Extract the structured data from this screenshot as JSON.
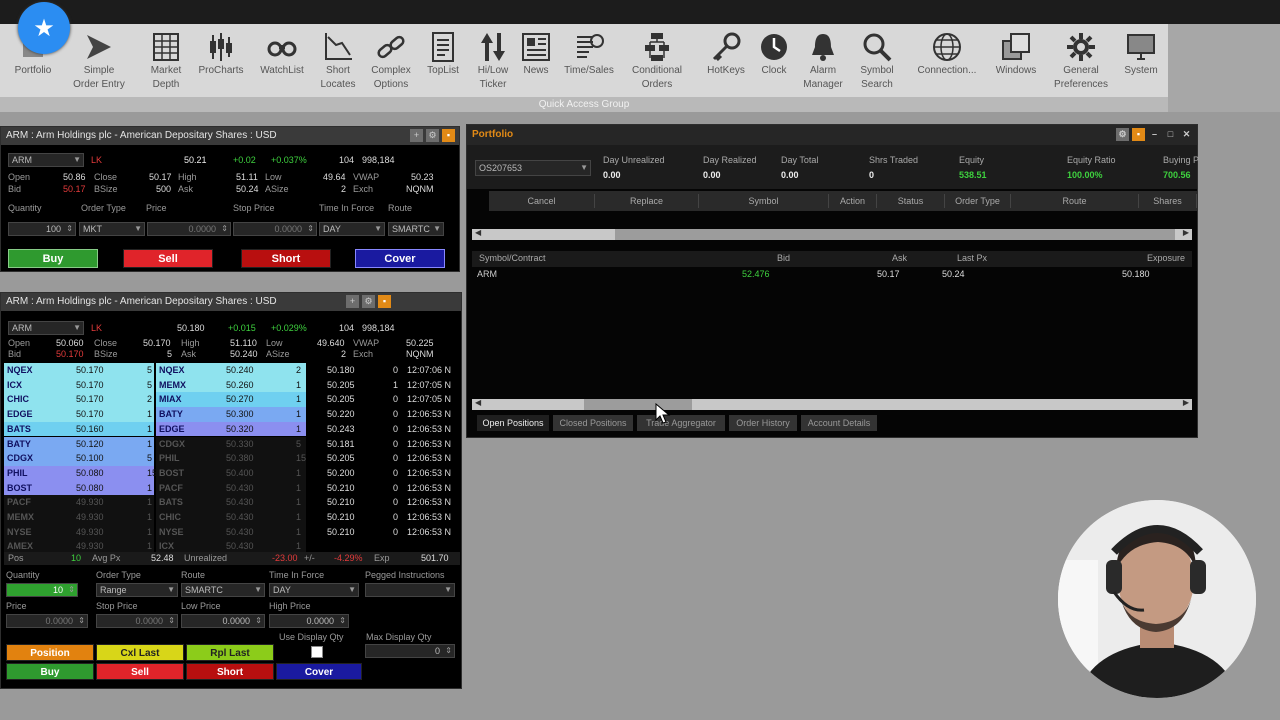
{
  "ribbon": {
    "items": [
      {
        "label": "Portfolio",
        "icon": "portfolio-icon"
      },
      {
        "label": "Simple\nOrder Entry",
        "icon": "arrow-right-icon"
      },
      {
        "label": "Market\nDepth",
        "icon": "table-icon"
      },
      {
        "label": "ProCharts",
        "icon": "candlestick-icon"
      },
      {
        "label": "WatchList",
        "icon": "binoculars-icon"
      },
      {
        "label": "Short\nLocates",
        "icon": "chart-down-icon"
      },
      {
        "label": "Complex\nOptions",
        "icon": "link-icon"
      },
      {
        "label": "TopList",
        "icon": "list-icon"
      },
      {
        "label": "Hi/Low\nTicker",
        "icon": "up-down-arrows-icon"
      },
      {
        "label": "News",
        "icon": "news-icon"
      },
      {
        "label": "Time/Sales",
        "icon": "time-sales-icon"
      },
      {
        "label": "Conditional\nOrders",
        "icon": "flowchart-icon"
      },
      {
        "label": "HotKeys",
        "icon": "key-icon"
      },
      {
        "label": "Clock",
        "icon": "clock-icon"
      },
      {
        "label": "Alarm\nManager",
        "icon": "bell-icon"
      },
      {
        "label": "Symbol\nSearch",
        "icon": "search-icon"
      },
      {
        "label": "Connection...",
        "icon": "globe-icon"
      },
      {
        "label": "Windows",
        "icon": "windows-icon"
      },
      {
        "label": "General\nPreferences",
        "icon": "gear-icon"
      },
      {
        "label": "System",
        "icon": "monitor-icon"
      }
    ],
    "group_label": "Quick Access Group"
  },
  "order_entry": {
    "title": "ARM : Arm Holdings plc - American Depositary Shares : USD",
    "symbol": "ARM",
    "flag": "LK",
    "last": "50.21",
    "change": "+0.02",
    "change_pct": "+0.037%",
    "volume": "104",
    "total_volume": "998,184",
    "labels": {
      "open": "Open",
      "close": "Close",
      "high": "High",
      "low": "Low",
      "vwap": "VWAP",
      "bid": "Bid",
      "bsize": "BSize",
      "ask": "Ask",
      "asize": "ASize",
      "exch": "Exch"
    },
    "open": "50.86",
    "close": "50.17",
    "high": "51.11",
    "low": "49.64",
    "vwap": "50.23",
    "bid": "50.17",
    "bsize": "500",
    "ask": "50.24",
    "asize": "2",
    "exch": "NQNM",
    "field_labels": {
      "quantity": "Quantity",
      "order_type": "Order Type",
      "price": "Price",
      "stop_price": "Stop Price",
      "tif": "Time In Force",
      "route": "Route"
    },
    "quantity": "100",
    "order_type": "MKT",
    "price": "0.0000",
    "stop_price": "0.0000",
    "tif": "DAY",
    "route": "SMARTC",
    "buttons": {
      "buy": "Buy",
      "sell": "Sell",
      "short": "Short",
      "cover": "Cover"
    }
  },
  "level2": {
    "title": "ARM : Arm Holdings plc - American Depositary Shares : USD",
    "symbol": "ARM",
    "flag": "LK",
    "last": "50.180",
    "change": "+0.015",
    "change_pct": "+0.029%",
    "volume": "104",
    "total_volume": "998,184",
    "open": "50.060",
    "close": "50.170",
    "high": "51.110",
    "low": "49.640",
    "vwap": "50.225",
    "bid": "50.170",
    "bsize": "5",
    "ask": "50.240",
    "asize": "2",
    "exch": "NQNM",
    "bids": [
      {
        "mm": "NQEX",
        "price": "50.170",
        "size": "5"
      },
      {
        "mm": "ICX",
        "price": "50.170",
        "size": "5"
      },
      {
        "mm": "CHIC",
        "price": "50.170",
        "size": "2"
      },
      {
        "mm": "EDGE",
        "price": "50.170",
        "size": "1"
      },
      {
        "mm": "BATS",
        "price": "50.160",
        "size": "1"
      },
      {
        "mm": "BATY",
        "price": "50.120",
        "size": "1"
      },
      {
        "mm": "CDGX",
        "price": "50.100",
        "size": "5"
      },
      {
        "mm": "PHIL",
        "price": "50.080",
        "size": "15"
      },
      {
        "mm": "BOST",
        "price": "50.080",
        "size": "1"
      },
      {
        "mm": "PACF",
        "price": "49.930",
        "size": "1"
      },
      {
        "mm": "MEMX",
        "price": "49.930",
        "size": "1"
      },
      {
        "mm": "NYSE",
        "price": "49.930",
        "size": "1"
      },
      {
        "mm": "AMEX",
        "price": "49.930",
        "size": "1"
      }
    ],
    "asks": [
      {
        "mm": "NQEX",
        "price": "50.240",
        "size": "2"
      },
      {
        "mm": "MEMX",
        "price": "50.260",
        "size": "1"
      },
      {
        "mm": "MIAX",
        "price": "50.270",
        "size": "1"
      },
      {
        "mm": "BATY",
        "price": "50.300",
        "size": "1"
      },
      {
        "mm": "EDGE",
        "price": "50.320",
        "size": "1"
      },
      {
        "mm": "CDGX",
        "price": "50.330",
        "size": "5"
      },
      {
        "mm": "PHIL",
        "price": "50.380",
        "size": "15"
      },
      {
        "mm": "BOST",
        "price": "50.400",
        "size": "1"
      },
      {
        "mm": "PACF",
        "price": "50.430",
        "size": "1"
      },
      {
        "mm": "BATS",
        "price": "50.430",
        "size": "1"
      },
      {
        "mm": "CHIC",
        "price": "50.430",
        "size": "1"
      },
      {
        "mm": "NYSE",
        "price": "50.430",
        "size": "1"
      },
      {
        "mm": "ICX",
        "price": "50.430",
        "size": "1"
      }
    ],
    "trades": [
      {
        "price": "50.180",
        "size": "0",
        "time": "12:07:06 N"
      },
      {
        "price": "50.205",
        "size": "1",
        "time": "12:07:05 N"
      },
      {
        "price": "50.205",
        "size": "0",
        "time": "12:07:05 N"
      },
      {
        "price": "50.220",
        "size": "0",
        "time": "12:06:53 N"
      },
      {
        "price": "50.243",
        "size": "0",
        "time": "12:06:53 N"
      },
      {
        "price": "50.181",
        "size": "0",
        "time": "12:06:53 N"
      },
      {
        "price": "50.205",
        "size": "0",
        "time": "12:06:53 N"
      },
      {
        "price": "50.200",
        "size": "0",
        "time": "12:06:53 N"
      },
      {
        "price": "50.210",
        "size": "0",
        "time": "12:06:53 N"
      },
      {
        "price": "50.210",
        "size": "0",
        "time": "12:06:53 N"
      },
      {
        "price": "50.210",
        "size": "0",
        "time": "12:06:53 N"
      },
      {
        "price": "50.210",
        "size": "0",
        "time": "12:06:53 N"
      }
    ],
    "pos_bar": {
      "pos_label": "Pos",
      "pos": "10",
      "avg_label": "Avg Px",
      "avg": "52.48",
      "unreal_label": "Unrealized",
      "unreal": "-23.00",
      "pct_label": "+/-",
      "pct": "-4.29%",
      "exp_label": "Exp",
      "exp": "501.70"
    },
    "field_labels": {
      "quantity": "Quantity",
      "order_type": "Order Type",
      "route": "Route",
      "tif": "Time In Force",
      "pegged": "Pegged Instructions",
      "price": "Price",
      "stop_price": "Stop Price",
      "low_price": "Low Price",
      "high_price": "High Price",
      "use_display": "Use Display Qty",
      "max_display": "Max Display Qty"
    },
    "quantity": "10",
    "order_type": "Range",
    "route": "SMARTC",
    "tif": "DAY",
    "price": "0.0000",
    "stop_price": "0.0000",
    "low_price": "0.0000",
    "high_price": "0.0000",
    "max_display": "0",
    "buttons": {
      "position": "Position",
      "cxl_last": "Cxl Last",
      "rpl_last": "Rpl Last",
      "buy": "Buy",
      "sell": "Sell",
      "short": "Short",
      "cover": "Cover"
    }
  },
  "portfolio": {
    "title": "Portfolio",
    "account": "OS207653",
    "summary": [
      {
        "label": "Day Unrealized",
        "value": "0.00"
      },
      {
        "label": "Day Realized",
        "value": "0.00"
      },
      {
        "label": "Day Total",
        "value": "0.00"
      },
      {
        "label": "Shrs Traded",
        "value": "0"
      },
      {
        "label": "Equity",
        "value": "538.51"
      },
      {
        "label": "Equity Ratio",
        "value": "100.00%"
      },
      {
        "label": "Buying P",
        "value": "700.56"
      }
    ],
    "order_columns": [
      "Cancel",
      "Replace",
      "Symbol",
      "Action",
      "Status",
      "Order Type",
      "Route",
      "Shares"
    ],
    "pos_columns": [
      "Symbol/Contract",
      "Bid",
      "Ask",
      "Last Px",
      "Exposure"
    ],
    "positions": [
      {
        "symbol": "ARM",
        "qty": "52.476",
        "bid": "50.17",
        "last": "50.24",
        "exposure": "50.180"
      }
    ],
    "tabs": [
      "Open Positions",
      "Closed Positions",
      "Trade Aggregator",
      "Order History",
      "Account Details"
    ]
  },
  "colors": {
    "buy": "#2f9a2f",
    "sell": "#e0242a",
    "short": "#b80f0f",
    "cover": "#1a1aa0",
    "position": "#e2820f",
    "cxl": "#d8d618",
    "rpl": "#8ccc1a",
    "accent_orange": "#e28a16"
  }
}
